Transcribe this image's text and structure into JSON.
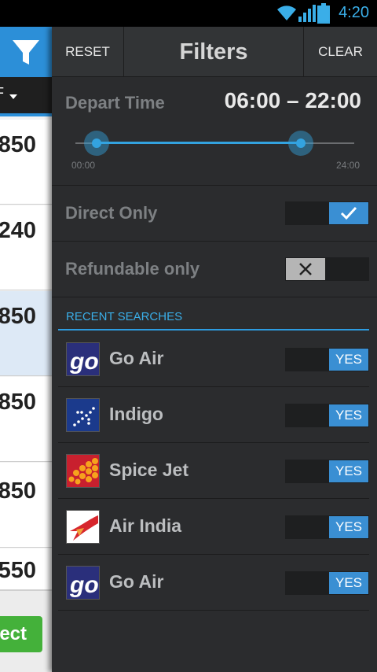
{
  "status_bar": {
    "time": "4:20",
    "accent": "#3aaee8"
  },
  "left_list": {
    "sort_label": "F",
    "prices": [
      "850",
      "240",
      "850",
      "850",
      "850",
      "550"
    ],
    "selected_index": 2,
    "select_label": "ect"
  },
  "filters": {
    "reset_label": "RESET",
    "title": "Filters",
    "clear_label": "CLEAR",
    "depart_time": {
      "label": "Depart Time",
      "range": "06:00 – 22:00",
      "min_label": "00:00",
      "max_label": "24:00",
      "min_hours": 0,
      "max_hours": 24,
      "low_hours": 6,
      "high_hours": 22
    },
    "direct_only": {
      "label": "Direct Only",
      "checked": true,
      "icon": "check-icon"
    },
    "refundable_only": {
      "label": "Refundable only",
      "checked": false,
      "icon": "x-icon"
    },
    "recent_searches_header": "RECENT SEARCHES",
    "recent_searches": [
      {
        "name": "Go Air",
        "value": "YES",
        "logo": "goair"
      },
      {
        "name": "Indigo",
        "value": "YES",
        "logo": "indigo"
      },
      {
        "name": "Spice Jet",
        "value": "YES",
        "logo": "spice"
      },
      {
        "name": "Air India",
        "value": "YES",
        "logo": "airindia"
      },
      {
        "name": "Go Air",
        "value": "YES",
        "logo": "goair"
      }
    ]
  },
  "colors": {
    "accent": "#33a3e0",
    "toggle_on": "#3a8fd3",
    "select": "#44b13a",
    "panel": "#2b2c2e"
  }
}
